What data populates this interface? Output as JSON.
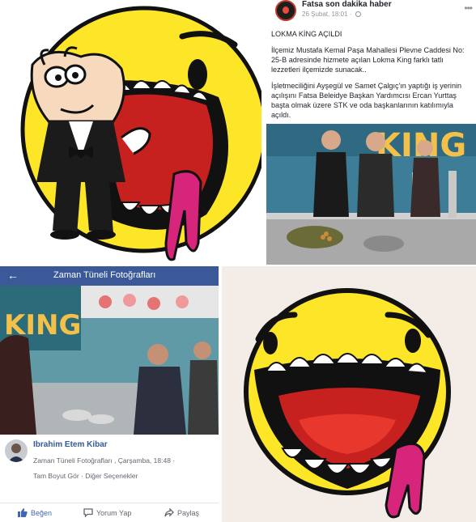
{
  "news_post": {
    "page_name": "Fatsa son dakika haber",
    "date": "26 Şubat, 18:01 ·",
    "title": "LOKMA KİNG AÇILDI",
    "paragraph_1": "İlçemiz Mustafa Kemal Paşa Mahallesi Plevne Caddesi No: 25-B adresinde hizmete açılan Lokma King farklı tatlı lezzetleri ilçemizde sunacak..",
    "paragraph_2": "İşletmeciliğini Ayşegül ve Samet Çalgıç'ın yaptığı iş yerinin açılışını Fatsa Beleidye Başkan Yardımcısı Ercan Yurttaş başta olmak üzere STK ve oda başkanlarının katılımıyla açıldı.",
    "photo_sign": "KING"
  },
  "album_view": {
    "title": "Zaman Tüneli Fotoğrafları",
    "photo_sign": "KING",
    "user_name": "Ibrahim Etem Kibar",
    "meta": "Zaman Tüneli Fotoğrafları , Çarşamba, 18:48 ·",
    "links": "Tam Boyut Gör · Diğer Seçenekler",
    "actions": [
      {
        "label": "Beğen",
        "icon": "thumbs-up-icon"
      },
      {
        "label": "Yorum Yap",
        "icon": "comment-icon"
      },
      {
        "label": "Paylaş",
        "icon": "share-icon"
      }
    ]
  },
  "colors": {
    "facebook_blue": "#3b5998",
    "logo_yellow": "#fde528",
    "logo_magenta": "#d6257a",
    "mouth_red": "#c6201f"
  }
}
